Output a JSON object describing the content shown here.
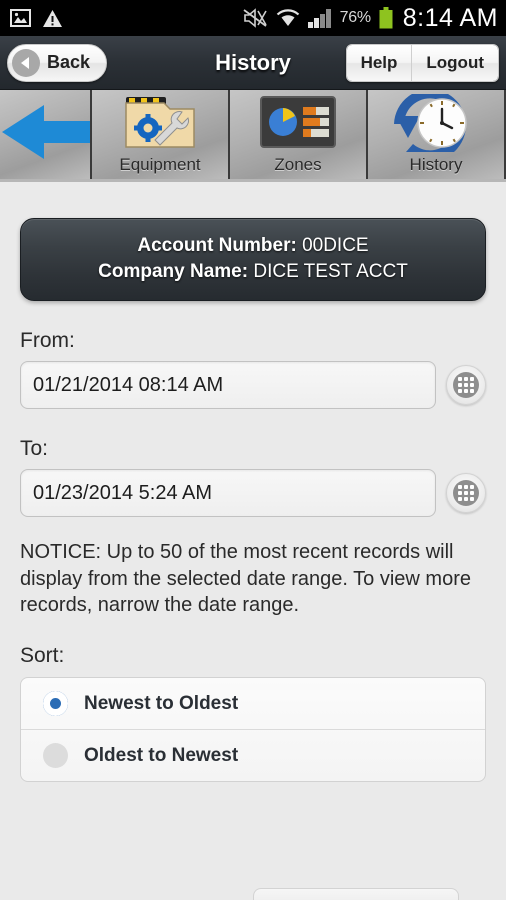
{
  "statusbar": {
    "icons": [
      "screenshot-image-icon",
      "warning-triangle-icon",
      "volume-mute-icon",
      "wifi-icon",
      "cell-signal-icon"
    ],
    "battery_percent": "76%",
    "time": "8:14 AM"
  },
  "header": {
    "back_label": "Back",
    "title": "History",
    "help_label": "Help",
    "logout_label": "Logout"
  },
  "toolbar": {
    "tiles": [
      {
        "label": "",
        "icon": "blue-left-arrow-icon"
      },
      {
        "label": "Equipment",
        "icon": "equipment-folder-gear-wrench-icon"
      },
      {
        "label": "Zones",
        "icon": "zones-chart-icon"
      },
      {
        "label": "History",
        "icon": "history-clock-arrow-icon"
      }
    ]
  },
  "account": {
    "account_number_label": "Account Number:",
    "account_number_value": "00DICE",
    "company_name_label": "Company Name:",
    "company_name_value": "DICE TEST ACCT"
  },
  "form": {
    "from_label": "From:",
    "from_value": "01/21/2014 08:14 AM",
    "to_label": "To:",
    "to_value": "01/23/2014 5:24 AM",
    "notice": "NOTICE: Up to 50 of the most recent records will display from the selected date range. To view more records, narrow the date range.",
    "sort_label": "Sort:",
    "sort_options": [
      {
        "label": "Newest to Oldest",
        "selected": true
      },
      {
        "label": "Oldest to Newest",
        "selected": false
      }
    ]
  },
  "colors": {
    "header_bg": "#2b3036",
    "accent_blue": "#2b6cb5",
    "page_bg": "#eaeaea",
    "battery_green": "#8ec31f"
  }
}
